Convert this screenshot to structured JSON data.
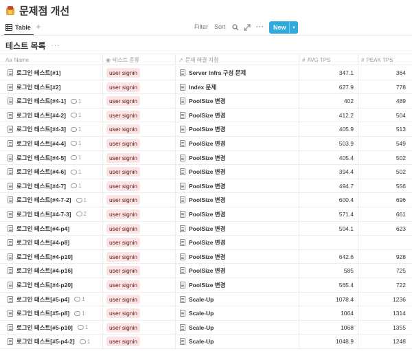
{
  "page": {
    "title": "문제점 개선",
    "emoji": "folder-icon"
  },
  "toolbar": {
    "view_label": "Table",
    "add_view": "+",
    "filter": "Filter",
    "sort": "Sort",
    "search_icon": "⌕",
    "expand_icon": "⤡",
    "more": "···",
    "new_label": "New",
    "new_drop": "⌄"
  },
  "database": {
    "title": "테스트 목록",
    "more": "···"
  },
  "columns": [
    {
      "label": "Name",
      "icon": "Aa"
    },
    {
      "label": "테스트 종류",
      "icon": "◉"
    },
    {
      "label": "문제 해결 지점",
      "icon": "↗"
    },
    {
      "label": "AVG TPS",
      "icon": "#"
    },
    {
      "label": "PEAK TPS",
      "icon": "#"
    }
  ],
  "rows": [
    {
      "name": "로그인 테스트[#1]",
      "comments": "",
      "type": "user signin",
      "location": "Server Infra 구성 문제",
      "avg": "347.1",
      "peak": "364"
    },
    {
      "name": "로그인 테스트[#2]",
      "comments": "",
      "type": "user signin",
      "location": "Index 문제",
      "avg": "627.9",
      "peak": "778"
    },
    {
      "name": "로그인 테스트[#4-1]",
      "comments": "1",
      "type": "user signin",
      "location": "PoolSize 변경",
      "avg": "402",
      "peak": "489"
    },
    {
      "name": "로그인 테스트[#4-2]",
      "comments": "1",
      "type": "user signin",
      "location": "PoolSize 변경",
      "avg": "412.2",
      "peak": "504"
    },
    {
      "name": "로그인 테스트[#4-3]",
      "comments": "1",
      "type": "user signin",
      "location": "PoolSize 변경",
      "avg": "405.9",
      "peak": "513"
    },
    {
      "name": "로그인 테스트[#4-4]",
      "comments": "1",
      "type": "user signin",
      "location": "PoolSize 변경",
      "avg": "503.9",
      "peak": "549"
    },
    {
      "name": "로그인 테스트[#4-5]",
      "comments": "1",
      "type": "user signin",
      "location": "PoolSize 변경",
      "avg": "405.4",
      "peak": "502"
    },
    {
      "name": "로그인 테스트[#4-6]",
      "comments": "1",
      "type": "user signin",
      "location": "PoolSize 변경",
      "avg": "394.4",
      "peak": "502"
    },
    {
      "name": "로그인 테스트[#4-7]",
      "comments": "1",
      "type": "user signin",
      "location": "PoolSize 변경",
      "avg": "494.7",
      "peak": "556"
    },
    {
      "name": "로그인 테스트[#4-7-2]",
      "comments": "1",
      "type": "user signin",
      "location": "PoolSize 변경",
      "avg": "600.4",
      "peak": "696"
    },
    {
      "name": "로그인 테스트[#4-7-3]",
      "comments": "2",
      "type": "user signin",
      "location": "PoolSize 변경",
      "avg": "571.4",
      "peak": "661"
    },
    {
      "name": "로그인 테스트[#4-p4]",
      "comments": "",
      "type": "user signin",
      "location": "PoolSize 변경",
      "avg": "504.1",
      "peak": "623"
    },
    {
      "name": "로그인 테스트[#4-p8]",
      "comments": "",
      "type": "user signin",
      "location": "PoolSize 변경",
      "avg": "",
      "peak": ""
    },
    {
      "name": "로그인 테스트[#4-p10]",
      "comments": "",
      "type": "user signin",
      "location": "PoolSize 변경",
      "avg": "642.6",
      "peak": "928"
    },
    {
      "name": "로그인 테스트[#4-p16]",
      "comments": "",
      "type": "user signin",
      "location": "PoolSize 변경",
      "avg": "585",
      "peak": "725"
    },
    {
      "name": "로그인 테스트[#4-p20]",
      "comments": "",
      "type": "user signin",
      "location": "PoolSize 변경",
      "avg": "565.4",
      "peak": "722"
    },
    {
      "name": "로그인 테스트[#5-p4]",
      "comments": "1",
      "type": "user signin",
      "location": "Scale-Up",
      "avg": "1078.4",
      "peak": "1236"
    },
    {
      "name": "로그인 테스트[#5-p8]",
      "comments": "1",
      "type": "user signin",
      "location": "Scale-Up",
      "avg": "1064",
      "peak": "1314"
    },
    {
      "name": "로그인 테스트[#5-p10]",
      "comments": "1",
      "type": "user signin",
      "location": "Scale-Up",
      "avg": "1068",
      "peak": "1355"
    },
    {
      "name": "로그인 테스트[#5-p4-2]",
      "comments": "1",
      "type": "user signin",
      "location": "Scale-Up",
      "avg": "1048.9",
      "peak": "1248"
    }
  ],
  "colors": {
    "accent": "#2eaadc",
    "tag_bg": "#fbe4e4",
    "tag_text": "#5d1715",
    "text": "#37352f",
    "muted": "#9b9a97"
  }
}
